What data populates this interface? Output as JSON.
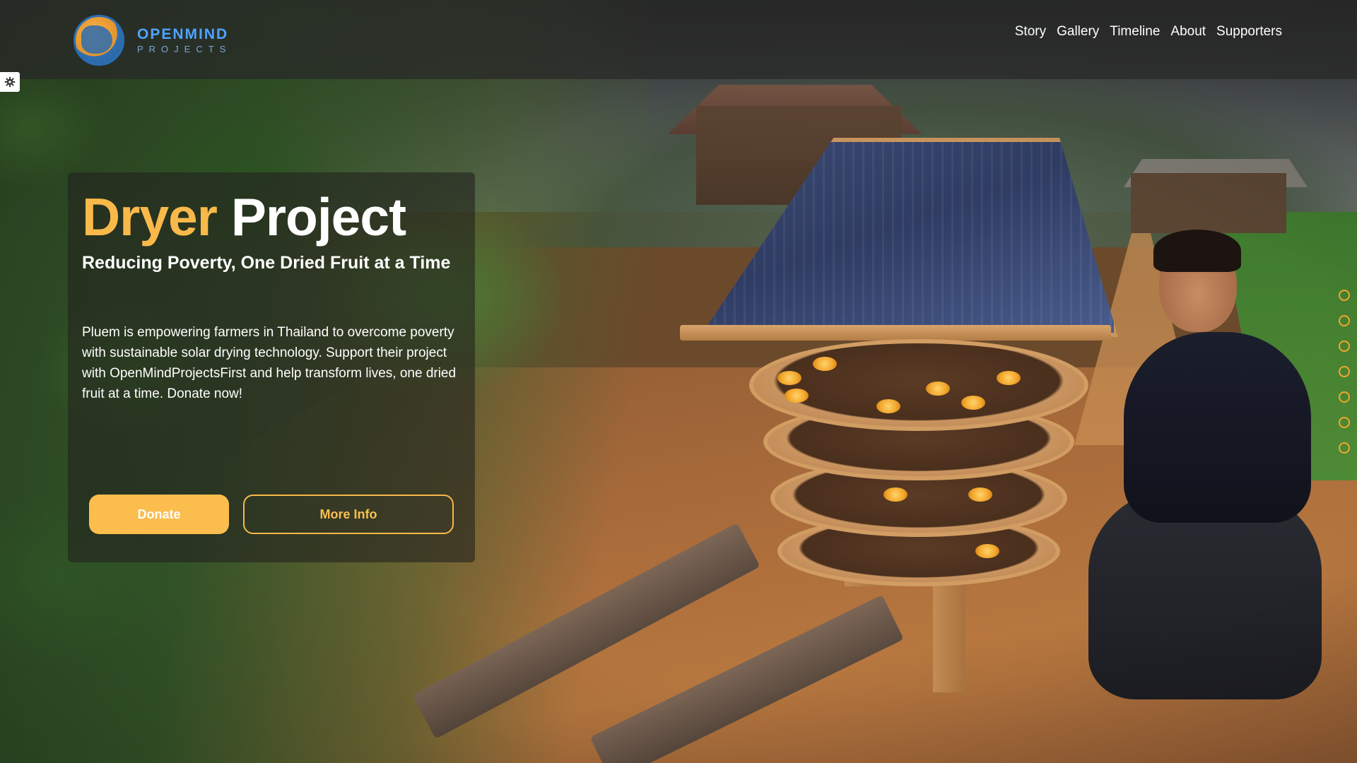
{
  "header": {
    "logo": {
      "name": "OPENMIND",
      "sub": "PROJECTS",
      "icon": "globe-icon"
    },
    "nav": [
      {
        "label": "Story"
      },
      {
        "label": "Gallery"
      },
      {
        "label": "Timeline"
      },
      {
        "label": "About"
      },
      {
        "label": "Supporters"
      }
    ]
  },
  "settings": {
    "icon": "gear-icon"
  },
  "hero": {
    "title_accent": "Dryer",
    "title_rest": "Project",
    "subtitle": "Reducing Poverty, One Dried Fruit at a Time",
    "body": "Pluem is empowering farmers in Thailand to overcome poverty with sustainable solar drying technology. Support their project with OpenMindProjectsFirst and help transform lives, one dried fruit at a time. Donate now!",
    "buttons": {
      "donate": "Donate",
      "more_info": "More Info"
    }
  },
  "slider": {
    "dot_count": 7
  },
  "colors": {
    "accent": "#f9b94a",
    "button_fill": "#fbbd4d",
    "logo_blue": "#4fa3ff",
    "header_bg": "#282828"
  }
}
